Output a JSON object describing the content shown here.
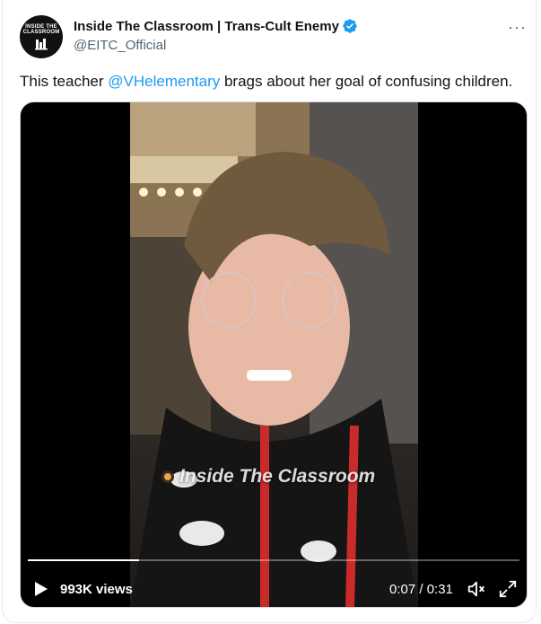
{
  "author": {
    "display_name": "Inside The Classroom | Trans-Cult Enemy",
    "handle": "@EITC_Official",
    "avatar_text_line1": "INSIDE THE",
    "avatar_text_line2": "CLASSROOM",
    "verified": true
  },
  "more_menu_icon": "ellipsis-icon",
  "tweet": {
    "text_before": "This teacher ",
    "mention": "@VHelementary",
    "text_after": " brags about her goal of confusing children."
  },
  "video": {
    "watermark": "Inside The Classroom",
    "views": "993K views",
    "time": "0:07 / 0:31",
    "progress_fraction": 0.226
  },
  "colors": {
    "accent": "#1d9bf0",
    "verified": "#1d9bf0",
    "secondary_text": "#536471"
  }
}
